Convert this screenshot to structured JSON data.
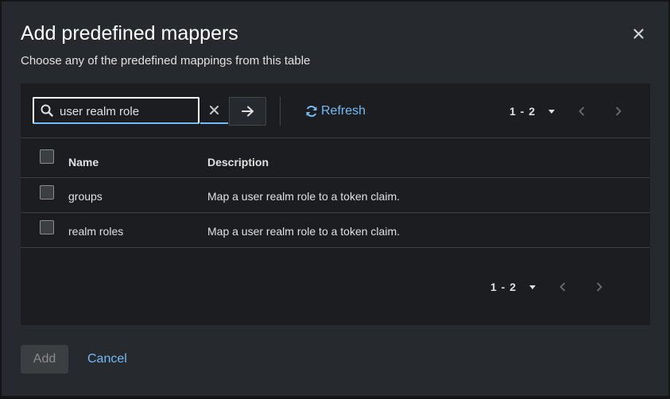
{
  "modal": {
    "title": "Add predefined mappers",
    "description": "Choose any of the predefined mappings from this table"
  },
  "toolbar": {
    "search_value": "user realm role",
    "refresh_label": "Refresh",
    "pagination_range": "1 - 2"
  },
  "table": {
    "columns": [
      "Name",
      "Description"
    ],
    "rows": [
      {
        "name": "groups",
        "description": "Map a user realm role to a token claim."
      },
      {
        "name": "realm roles",
        "description": "Map a user realm role to a token claim."
      }
    ]
  },
  "bottom_pagination": {
    "range": "1 - 2"
  },
  "footer": {
    "add_label": "Add",
    "cancel_label": "Cancel"
  },
  "colors": {
    "accent": "#73bcf7",
    "panel": "#1b1d21",
    "modal": "#26292d"
  }
}
